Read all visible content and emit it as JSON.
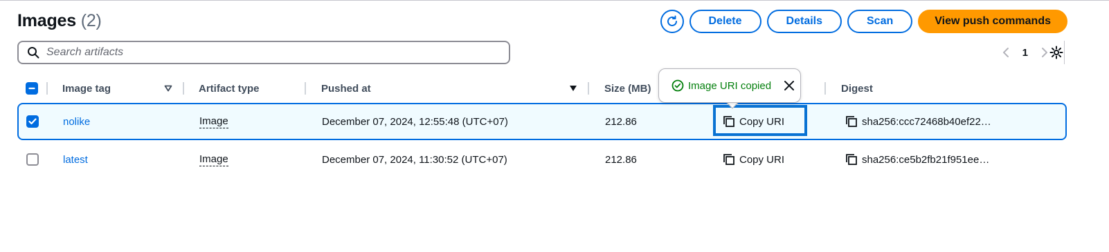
{
  "header": {
    "title": "Images",
    "count": "(2)"
  },
  "actions": {
    "refresh_icon": "refresh-icon",
    "delete_label": "Delete",
    "details_label": "Details",
    "scan_label": "Scan",
    "push_label": "View push commands"
  },
  "search": {
    "placeholder": "Search artifacts",
    "value": ""
  },
  "pagination": {
    "current_page": "1"
  },
  "table": {
    "columns": {
      "image_tag": "Image tag",
      "artifact_type": "Artifact type",
      "pushed_at": "Pushed at",
      "size": "Size (MB)",
      "digest": "Digest"
    },
    "rows": [
      {
        "selected": true,
        "tag": "nolike",
        "artifact_type": "Image",
        "pushed_at": "December 07, 2024, 12:55:48 (UTC+07)",
        "size": "212.86",
        "copy_label": "Copy URI",
        "digest": "sha256:ccc72468b40ef22…"
      },
      {
        "selected": false,
        "tag": "latest",
        "artifact_type": "Image",
        "pushed_at": "December 07, 2024, 11:30:52 (UTC+07)",
        "size": "212.86",
        "copy_label": "Copy URI",
        "digest": "sha256:ce5b2fb21f951ee…"
      }
    ]
  },
  "toast": {
    "message": "Image URI copied"
  },
  "colors": {
    "accent": "#006ce0",
    "primary_button": "#ff9900",
    "success": "#037f0c",
    "selected_row_bg": "#f0fbff"
  }
}
